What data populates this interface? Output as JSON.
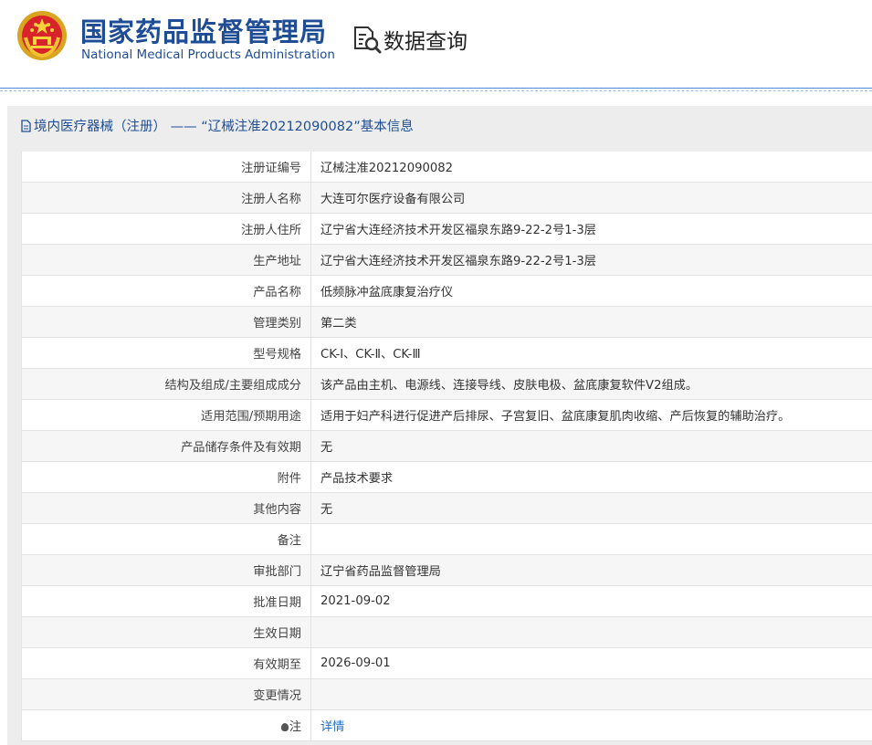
{
  "header": {
    "org_name_cn": "国家药品监督管理局",
    "org_name_en": "National Medical Products Administration",
    "data_query_label": "数据查询"
  },
  "panel": {
    "title": "境内医疗器械（注册） —— “辽械注准20212090082”基本信息"
  },
  "rows": [
    {
      "label": "注册证编号",
      "value": "辽械注准20212090082"
    },
    {
      "label": "注册人名称",
      "value": "大连可尔医疗设备有限公司"
    },
    {
      "label": "注册人住所",
      "value": "辽宁省大连经济技术开发区福泉东路9-22-2号1-3层"
    },
    {
      "label": "生产地址",
      "value": "辽宁省大连经济技术开发区福泉东路9-22-2号1-3层"
    },
    {
      "label": "产品名称",
      "value": "低频脉冲盆底康复治疗仪"
    },
    {
      "label": "管理类别",
      "value": "第二类"
    },
    {
      "label": "型号规格",
      "value": "CK-Ⅰ、CK-Ⅱ、CK-Ⅲ"
    },
    {
      "label": "结构及组成/主要组成成分",
      "value": "该产品由主机、电源线、连接导线、皮肤电极、盆底康复软件V2组成。"
    },
    {
      "label": "适用范围/预期用途",
      "value": "适用于妇产科进行促进产后排尿、子宫复旧、盆底康复肌肉收缩、产后恢复的辅助治疗。"
    },
    {
      "label": "产品储存条件及有效期",
      "value": "无"
    },
    {
      "label": "附件",
      "value": "产品技术要求"
    },
    {
      "label": "其他内容",
      "value": "无"
    },
    {
      "label": "备注",
      "value": ""
    },
    {
      "label": "审批部门",
      "value": "辽宁省药品监督管理局"
    },
    {
      "label": "批准日期",
      "value": "2021-09-02"
    },
    {
      "label": "生效日期",
      "value": ""
    },
    {
      "label": "有效期至",
      "value": "2026-09-01"
    },
    {
      "label": "变更情况",
      "value": ""
    }
  ],
  "note_row": {
    "label": "注",
    "link_text": "详情"
  },
  "colors": {
    "brand_blue": "#1e4d95",
    "link_blue": "#1e6fc6",
    "panel_bg": "#ededed"
  }
}
